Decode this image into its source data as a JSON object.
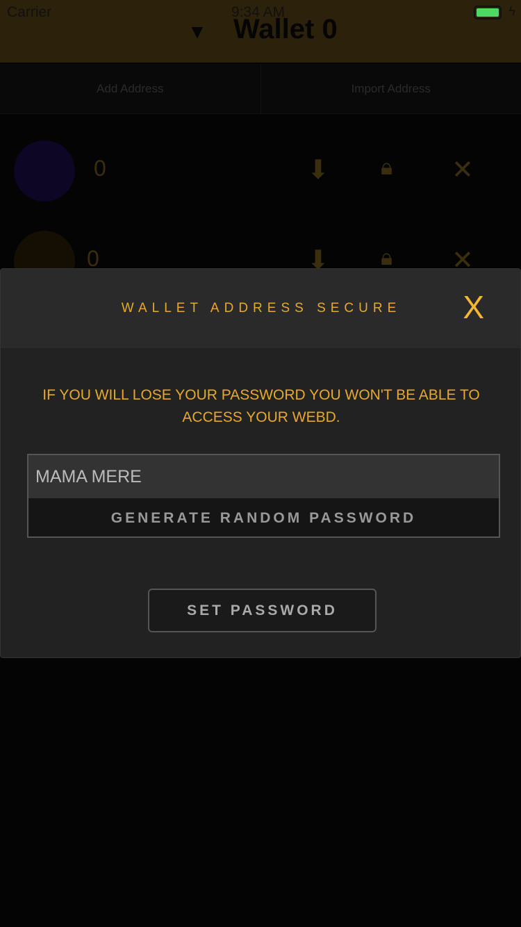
{
  "status": {
    "carrier": "Carrier",
    "time": "9:34 AM"
  },
  "header": {
    "title": "Wallet",
    "balance": "0"
  },
  "tabs": [
    "Add Address",
    "Import Address"
  ],
  "addresses": [
    {
      "balance": "0"
    },
    {
      "balance": "0"
    }
  ],
  "modal": {
    "title": "WALLET ADDRESS SECURE",
    "close": "X",
    "warning": "IF YOU WILL LOSE YOUR PASSWORD YOU WON'T BE ABLE TO ACCESS YOUR WEBD.",
    "password_value": "MAMA MERE",
    "generate_label": "GENERATE RANDOM PASSWORD",
    "set_label": "SET PASSWORD"
  }
}
